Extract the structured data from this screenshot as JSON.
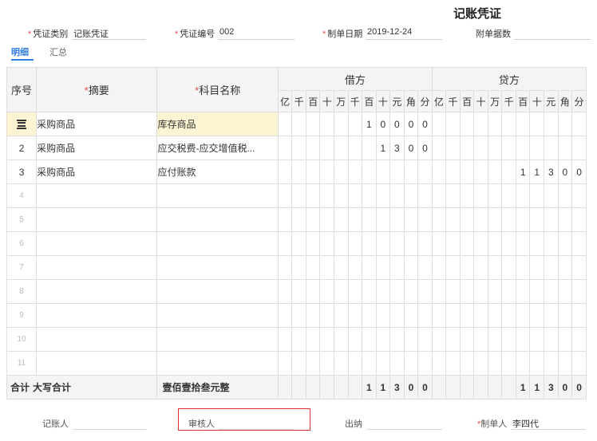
{
  "title": "记账凭证",
  "header": {
    "voucher_type_label": "凭证类别",
    "voucher_type_value": "记账凭证",
    "voucher_no_label": "凭证编号",
    "voucher_no_value": "002",
    "date_label": "制单日期",
    "date_value": "2019-12-24",
    "attachments_label": "附单据数",
    "attachments_value": ""
  },
  "tabs": [
    {
      "label": "明细",
      "active": true
    },
    {
      "label": "汇总",
      "active": false
    }
  ],
  "table": {
    "col_seq": "序号",
    "col_summary": "摘要",
    "col_account": "科目名称",
    "col_debit": "借方",
    "col_credit": "贷方",
    "units": [
      "亿",
      "千",
      "百",
      "十",
      "万",
      "千",
      "百",
      "十",
      "元",
      "角",
      "分"
    ],
    "rows": [
      {
        "seq": "",
        "summary": "采购商品",
        "account": "库存商品",
        "debit": [
          "",
          "",
          "",
          "",
          "",
          "",
          "1",
          "0",
          "0",
          "0",
          "0"
        ],
        "credit": [
          "",
          "",
          "",
          "",
          "",
          "",
          "",
          "",
          "",
          "",
          ""
        ]
      },
      {
        "seq": "2",
        "summary": "采购商品",
        "account": "应交税费-应交增值税...",
        "debit": [
          "",
          "",
          "",
          "",
          "",
          "",
          "",
          "1",
          "3",
          "0",
          "0"
        ],
        "credit": [
          "",
          "",
          "",
          "",
          "",
          "",
          "",
          "",
          "",
          "",
          ""
        ]
      },
      {
        "seq": "3",
        "summary": "采购商品",
        "account": "应付账款",
        "debit": [
          "",
          "",
          "",
          "",
          "",
          "",
          "",
          "",
          "",
          "",
          ""
        ],
        "credit": [
          "",
          "",
          "",
          "",
          "",
          "",
          "1",
          "1",
          "3",
          "0",
          "0"
        ]
      },
      {
        "seq": "4",
        "summary": "",
        "account": "",
        "debit": [
          "",
          "",
          "",
          "",
          "",
          "",
          "",
          "",
          "",
          "",
          ""
        ],
        "credit": [
          "",
          "",
          "",
          "",
          "",
          "",
          "",
          "",
          "",
          "",
          ""
        ]
      },
      {
        "seq": "5",
        "summary": "",
        "account": "",
        "debit": [
          "",
          "",
          "",
          "",
          "",
          "",
          "",
          "",
          "",
          "",
          ""
        ],
        "credit": [
          "",
          "",
          "",
          "",
          "",
          "",
          "",
          "",
          "",
          "",
          ""
        ]
      },
      {
        "seq": "6",
        "summary": "",
        "account": "",
        "debit": [
          "",
          "",
          "",
          "",
          "",
          "",
          "",
          "",
          "",
          "",
          ""
        ],
        "credit": [
          "",
          "",
          "",
          "",
          "",
          "",
          "",
          "",
          "",
          "",
          ""
        ]
      },
      {
        "seq": "7",
        "summary": "",
        "account": "",
        "debit": [
          "",
          "",
          "",
          "",
          "",
          "",
          "",
          "",
          "",
          "",
          ""
        ],
        "credit": [
          "",
          "",
          "",
          "",
          "",
          "",
          "",
          "",
          "",
          "",
          ""
        ]
      },
      {
        "seq": "8",
        "summary": "",
        "account": "",
        "debit": [
          "",
          "",
          "",
          "",
          "",
          "",
          "",
          "",
          "",
          "",
          ""
        ],
        "credit": [
          "",
          "",
          "",
          "",
          "",
          "",
          "",
          "",
          "",
          "",
          ""
        ]
      },
      {
        "seq": "9",
        "summary": "",
        "account": "",
        "debit": [
          "",
          "",
          "",
          "",
          "",
          "",
          "",
          "",
          "",
          "",
          ""
        ],
        "credit": [
          "",
          "",
          "",
          "",
          "",
          "",
          "",
          "",
          "",
          "",
          ""
        ]
      },
      {
        "seq": "10",
        "summary": "",
        "account": "",
        "debit": [
          "",
          "",
          "",
          "",
          "",
          "",
          "",
          "",
          "",
          "",
          ""
        ],
        "credit": [
          "",
          "",
          "",
          "",
          "",
          "",
          "",
          "",
          "",
          "",
          ""
        ]
      },
      {
        "seq": "11",
        "summary": "",
        "account": "",
        "debit": [
          "",
          "",
          "",
          "",
          "",
          "",
          "",
          "",
          "",
          "",
          ""
        ],
        "credit": [
          "",
          "",
          "",
          "",
          "",
          "",
          "",
          "",
          "",
          "",
          ""
        ]
      }
    ],
    "total": {
      "label": "合计",
      "uppercase_label": "大写合计",
      "uppercase_value": "壹佰壹拾叁元整",
      "debit": [
        "",
        "",
        "",
        "",
        "",
        "",
        "1",
        "1",
        "3",
        "0",
        "0"
      ],
      "credit": [
        "",
        "",
        "",
        "",
        "",
        "",
        "1",
        "1",
        "3",
        "0",
        "0"
      ]
    }
  },
  "footer": {
    "bookkeeper_label": "记账人",
    "bookkeeper_value": "",
    "reviewer_label": "审核人",
    "reviewer_value": "",
    "cashier_label": "出纳",
    "cashier_value": "",
    "preparer_label": "制单人",
    "preparer_value": "李四代"
  },
  "colors": {
    "accent": "#2f7de1",
    "required": "#e34d4d",
    "selected_row": "#fdf4d4",
    "highlight": "#e02e2e"
  }
}
